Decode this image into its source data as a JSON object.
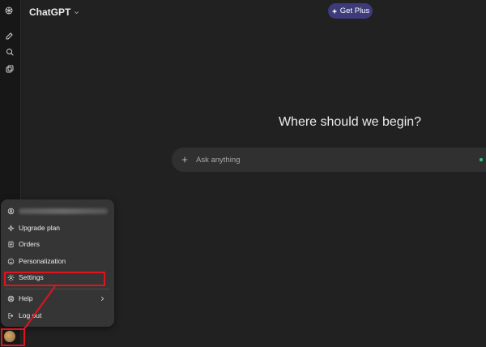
{
  "header": {
    "model_label": "ChatGPT",
    "get_plus_label": "Get Plus"
  },
  "sidebar": {
    "icons": [
      "openai-logo-icon",
      "new-chat-icon",
      "search-icon",
      "library-icon"
    ]
  },
  "main": {
    "headline": "Where should we begin?",
    "composer_placeholder": "Ask anything"
  },
  "account_menu": {
    "items": [
      {
        "label": "Upgrade plan",
        "icon": "sparkle-icon"
      },
      {
        "label": "Orders",
        "icon": "receipt-icon"
      },
      {
        "label": "Personalization",
        "icon": "smile-icon"
      },
      {
        "label": "Settings",
        "icon": "gear-icon"
      },
      {
        "label": "Help",
        "icon": "help-icon"
      },
      {
        "label": "Log out",
        "icon": "logout-icon"
      }
    ]
  },
  "colors": {
    "background": "#212121",
    "sidebar": "#171717",
    "menu": "#353535",
    "get_plus": "#3d3b7a",
    "highlight": "#e0141e"
  }
}
